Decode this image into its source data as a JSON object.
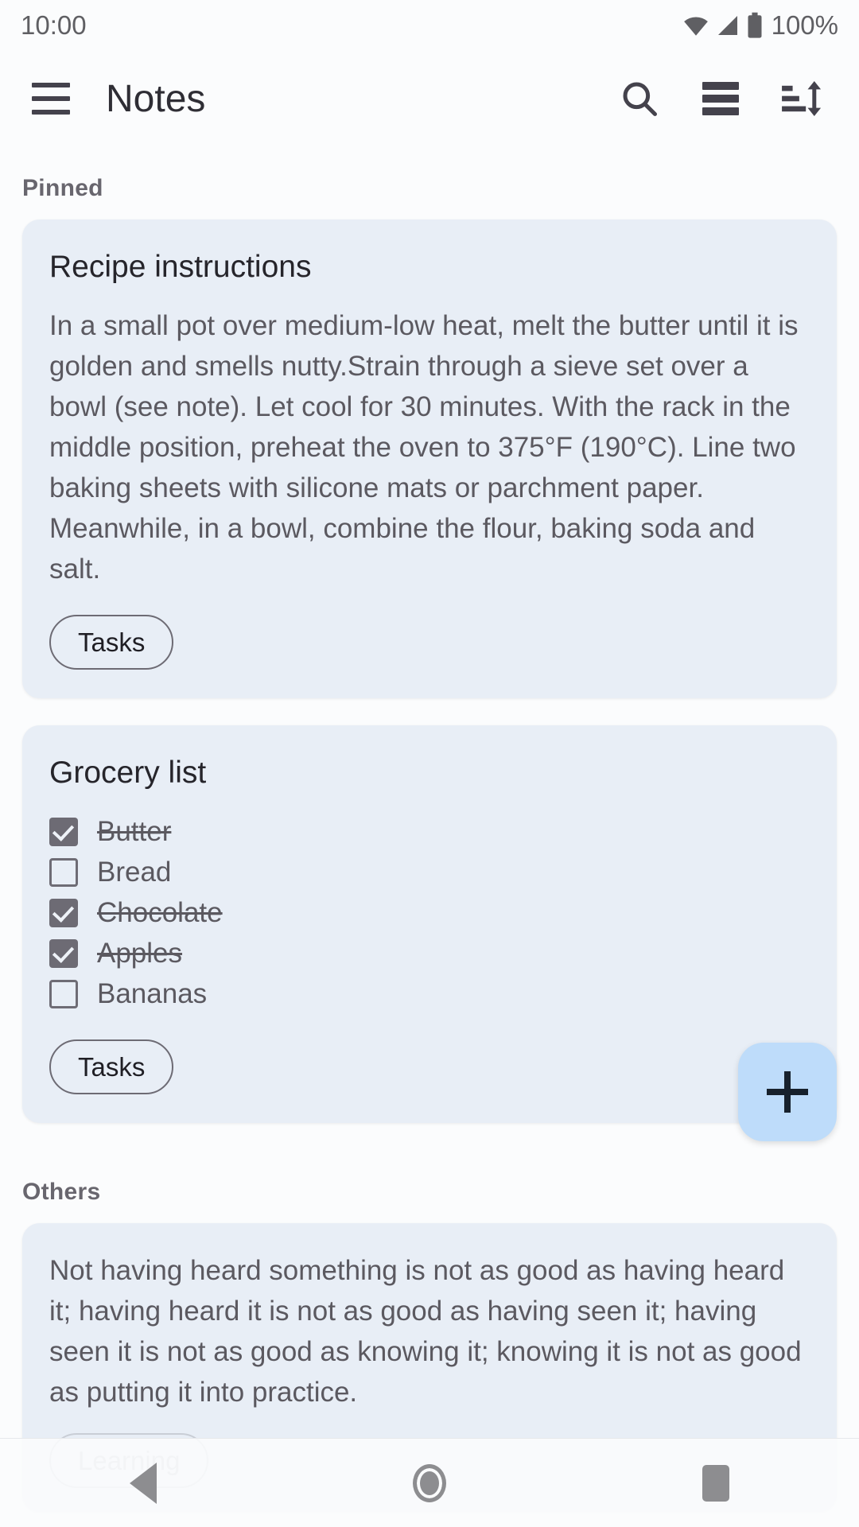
{
  "status_bar": {
    "time": "10:00",
    "battery_text": "100%",
    "icons": [
      "wifi-icon",
      "signal-icon",
      "battery-icon"
    ]
  },
  "app_bar": {
    "title": "Notes",
    "menu_icon": "hamburger-menu-icon",
    "actions": [
      {
        "name": "search-icon",
        "label": "Search"
      },
      {
        "name": "view-mode-icon",
        "label": "View mode"
      },
      {
        "name": "sort-icon",
        "label": "Sort"
      }
    ]
  },
  "sections": {
    "pinned_label": "Pinned",
    "others_label": "Others"
  },
  "notes": {
    "recipe": {
      "title": "Recipe instructions",
      "body": "In a small pot over medium-low heat, melt the butter until it is golden and smells nutty.Strain through a sieve set over a bowl (see note). Let cool for 30 minutes. With the rack in the middle position, preheat the oven to 375°F (190°C). Line two baking sheets with silicone mats or parchment paper. Meanwhile, in a bowl, combine the flour, baking soda and salt.",
      "chip_label": "Tasks"
    },
    "grocery": {
      "title": "Grocery list",
      "chip_label": "Tasks",
      "items": [
        {
          "label": "Butter",
          "checked": true
        },
        {
          "label": "Bread",
          "checked": false
        },
        {
          "label": "Chocolate",
          "checked": true
        },
        {
          "label": "Apples",
          "checked": true
        },
        {
          "label": "Bananas",
          "checked": false
        }
      ]
    },
    "learning": {
      "body": "Not having heard something is not as good as having heard it; having heard it is not as good as having seen it; having seen it is not as good as knowing it; knowing it is not as good as putting it into practice.",
      "chip_label": "Learning"
    }
  },
  "fab": {
    "name": "add-note-fab",
    "icon": "plus-icon",
    "color": "#bedcfa"
  },
  "nav_bar": {
    "back": "back-button",
    "home": "home-button",
    "recents": "recents-button"
  },
  "colors": {
    "card_background": "#e8eef6",
    "page_background": "#fbfcfd",
    "accent": "#bedcfa",
    "text_primary": "#26252b",
    "text_secondary": "#5b5960"
  }
}
